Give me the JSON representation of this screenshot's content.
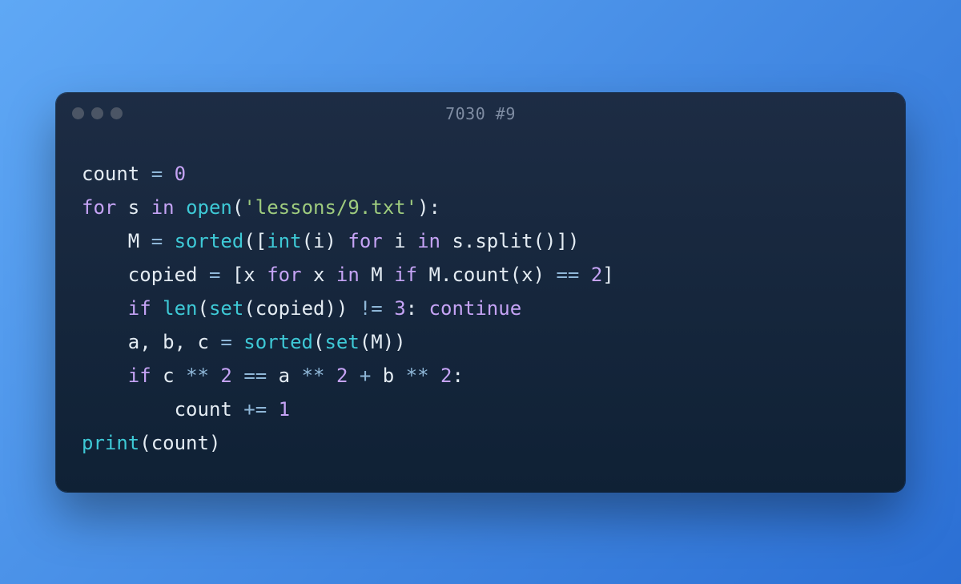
{
  "window": {
    "title": "7030 #9"
  },
  "code": {
    "lines": [
      [
        {
          "t": "count ",
          "c": ""
        },
        {
          "t": "=",
          "c": "tk-op"
        },
        {
          "t": " ",
          "c": ""
        },
        {
          "t": "0",
          "c": "tk-num"
        }
      ],
      [
        {
          "t": "for",
          "c": "tk-kw"
        },
        {
          "t": " s ",
          "c": ""
        },
        {
          "t": "in",
          "c": "tk-kw"
        },
        {
          "t": " ",
          "c": ""
        },
        {
          "t": "open",
          "c": "tk-fn"
        },
        {
          "t": "(",
          "c": ""
        },
        {
          "t": "'lessons/9.txt'",
          "c": "tk-str"
        },
        {
          "t": "):",
          "c": ""
        }
      ],
      [
        {
          "t": "    M ",
          "c": ""
        },
        {
          "t": "=",
          "c": "tk-op"
        },
        {
          "t": " ",
          "c": ""
        },
        {
          "t": "sorted",
          "c": "tk-fn"
        },
        {
          "t": "([",
          "c": ""
        },
        {
          "t": "int",
          "c": "tk-fn"
        },
        {
          "t": "(i) ",
          "c": ""
        },
        {
          "t": "for",
          "c": "tk-kw"
        },
        {
          "t": " i ",
          "c": ""
        },
        {
          "t": "in",
          "c": "tk-kw"
        },
        {
          "t": " s.split()])",
          "c": ""
        }
      ],
      [
        {
          "t": "    copied ",
          "c": ""
        },
        {
          "t": "=",
          "c": "tk-op"
        },
        {
          "t": " [x ",
          "c": ""
        },
        {
          "t": "for",
          "c": "tk-kw"
        },
        {
          "t": " x ",
          "c": ""
        },
        {
          "t": "in",
          "c": "tk-kw"
        },
        {
          "t": " M ",
          "c": ""
        },
        {
          "t": "if",
          "c": "tk-kw"
        },
        {
          "t": " M.count(x) ",
          "c": ""
        },
        {
          "t": "==",
          "c": "tk-op"
        },
        {
          "t": " ",
          "c": ""
        },
        {
          "t": "2",
          "c": "tk-num"
        },
        {
          "t": "]",
          "c": ""
        }
      ],
      [
        {
          "t": "    ",
          "c": ""
        },
        {
          "t": "if",
          "c": "tk-kw"
        },
        {
          "t": " ",
          "c": ""
        },
        {
          "t": "len",
          "c": "tk-fn"
        },
        {
          "t": "(",
          "c": ""
        },
        {
          "t": "set",
          "c": "tk-fn"
        },
        {
          "t": "(copied)) ",
          "c": ""
        },
        {
          "t": "!=",
          "c": "tk-op"
        },
        {
          "t": " ",
          "c": ""
        },
        {
          "t": "3",
          "c": "tk-num"
        },
        {
          "t": ": ",
          "c": ""
        },
        {
          "t": "continue",
          "c": "tk-kw"
        }
      ],
      [
        {
          "t": "    a, b, c ",
          "c": ""
        },
        {
          "t": "=",
          "c": "tk-op"
        },
        {
          "t": " ",
          "c": ""
        },
        {
          "t": "sorted",
          "c": "tk-fn"
        },
        {
          "t": "(",
          "c": ""
        },
        {
          "t": "set",
          "c": "tk-fn"
        },
        {
          "t": "(M))",
          "c": ""
        }
      ],
      [
        {
          "t": "    ",
          "c": ""
        },
        {
          "t": "if",
          "c": "tk-kw"
        },
        {
          "t": " c ",
          "c": ""
        },
        {
          "t": "**",
          "c": "tk-op"
        },
        {
          "t": " ",
          "c": ""
        },
        {
          "t": "2",
          "c": "tk-num"
        },
        {
          "t": " ",
          "c": ""
        },
        {
          "t": "==",
          "c": "tk-op"
        },
        {
          "t": " a ",
          "c": ""
        },
        {
          "t": "**",
          "c": "tk-op"
        },
        {
          "t": " ",
          "c": ""
        },
        {
          "t": "2",
          "c": "tk-num"
        },
        {
          "t": " ",
          "c": ""
        },
        {
          "t": "+",
          "c": "tk-op"
        },
        {
          "t": " b ",
          "c": ""
        },
        {
          "t": "**",
          "c": "tk-op"
        },
        {
          "t": " ",
          "c": ""
        },
        {
          "t": "2",
          "c": "tk-num"
        },
        {
          "t": ":",
          "c": ""
        }
      ],
      [
        {
          "t": "        count ",
          "c": ""
        },
        {
          "t": "+=",
          "c": "tk-op"
        },
        {
          "t": " ",
          "c": ""
        },
        {
          "t": "1",
          "c": "tk-num"
        }
      ],
      [
        {
          "t": "print",
          "c": "tk-fn"
        },
        {
          "t": "(count)",
          "c": ""
        }
      ]
    ]
  }
}
